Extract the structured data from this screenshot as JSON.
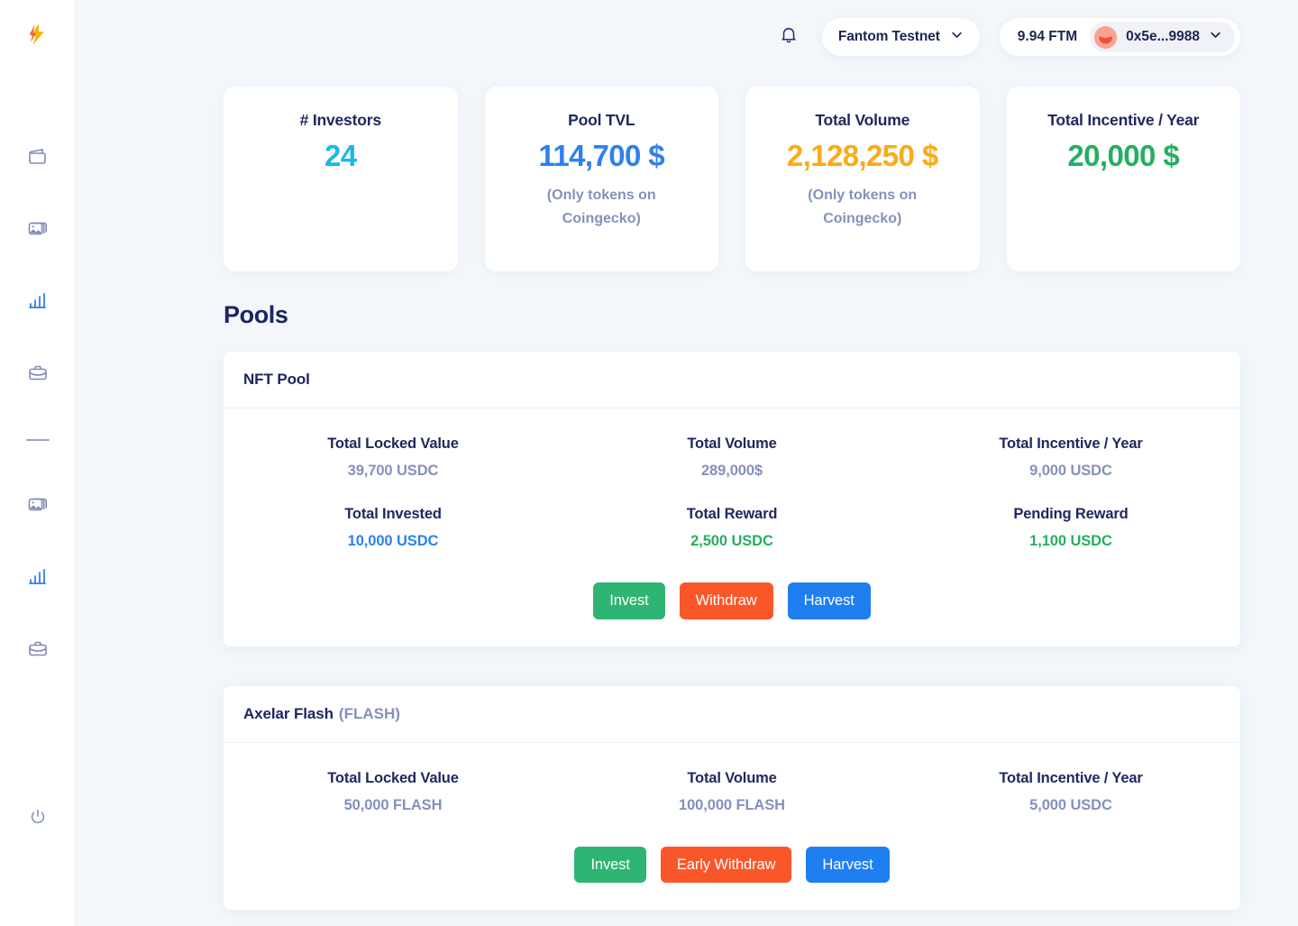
{
  "sidebar": {
    "logo": {
      "icon": "lightning-bolt-logo"
    },
    "items": [
      {
        "icon": "wallet-icon",
        "name": "wallet",
        "active": false
      },
      {
        "icon": "image-icon",
        "name": "gallery",
        "active": false
      },
      {
        "icon": "bar-chart-icon",
        "name": "analytics",
        "active": true
      },
      {
        "icon": "briefcase-icon",
        "name": "portfolio",
        "active": false
      },
      {
        "icon": "divider",
        "name": "divider",
        "active": false
      },
      {
        "icon": "image-icon",
        "name": "gallery-2",
        "active": false
      },
      {
        "icon": "bar-chart-icon",
        "name": "analytics-2",
        "active": true
      },
      {
        "icon": "briefcase-icon",
        "name": "portfolio-2",
        "active": false
      }
    ],
    "logout": {
      "icon": "power-icon",
      "name": "logout"
    }
  },
  "topbar": {
    "notifications_icon": "bell-icon",
    "network": {
      "label": "Fantom Testnet",
      "caret_icon": "chevron-down-icon"
    },
    "wallet": {
      "balance": "9.94 FTM",
      "address": "0x5e...9988",
      "avatar_icon": "wallet-avatar",
      "caret_icon": "chevron-down-icon"
    }
  },
  "stats": [
    {
      "title": "# Investors",
      "value": "24",
      "color": "#1cb8e8",
      "note": ""
    },
    {
      "title": "Pool TVL",
      "value": "114,700 $",
      "color": "#2f80ed",
      "note": "(Only tokens on Coingecko)"
    },
    {
      "title": "Total Volume",
      "value": "2,128,250 $",
      "color": "#fbab18",
      "note": "(Only tokens on Coingecko)"
    },
    {
      "title": "Total Incentive / Year",
      "value": "20,000 $",
      "color": "#27ae60",
      "note": ""
    }
  ],
  "section": {
    "heading": "Pools"
  },
  "pools": [
    {
      "name": "NFT Pool",
      "symbol": "",
      "rows": [
        [
          {
            "label": "Total Locked Value",
            "value": "39,700 USDC",
            "style": "v-muted"
          },
          {
            "label": "Total Volume",
            "value": "289,000$",
            "style": "v-muted"
          },
          {
            "label": "Total Incentive / Year",
            "value": "9,000 USDC",
            "style": "v-muted"
          }
        ],
        [
          {
            "label": "Total Invested",
            "value": "10,000 USDC",
            "style": "v-blue"
          },
          {
            "label": "Total Reward",
            "value": "2,500 USDC",
            "style": "v-green"
          },
          {
            "label": "Pending Reward",
            "value": "1,100 USDC",
            "style": "v-green"
          }
        ]
      ],
      "buttons": [
        {
          "label": "Invest",
          "style": "btn-green"
        },
        {
          "label": "Withdraw",
          "style": "btn-orange"
        },
        {
          "label": "Harvest",
          "style": "btn-blue"
        }
      ]
    },
    {
      "name": "Axelar Flash",
      "symbol": "(FLASH)",
      "rows": [
        [
          {
            "label": "Total Locked Value",
            "value": "50,000 FLASH",
            "style": "v-muted"
          },
          {
            "label": "Total Volume",
            "value": "100,000 FLASH",
            "style": "v-muted"
          },
          {
            "label": "Total Incentive / Year",
            "value": "5,000 USDC",
            "style": "v-muted"
          }
        ]
      ],
      "buttons": [
        {
          "label": "Invest",
          "style": "btn-green"
        },
        {
          "label": "Early Withdraw",
          "style": "btn-orange"
        },
        {
          "label": "Harvest",
          "style": "btn-blue"
        }
      ]
    }
  ]
}
